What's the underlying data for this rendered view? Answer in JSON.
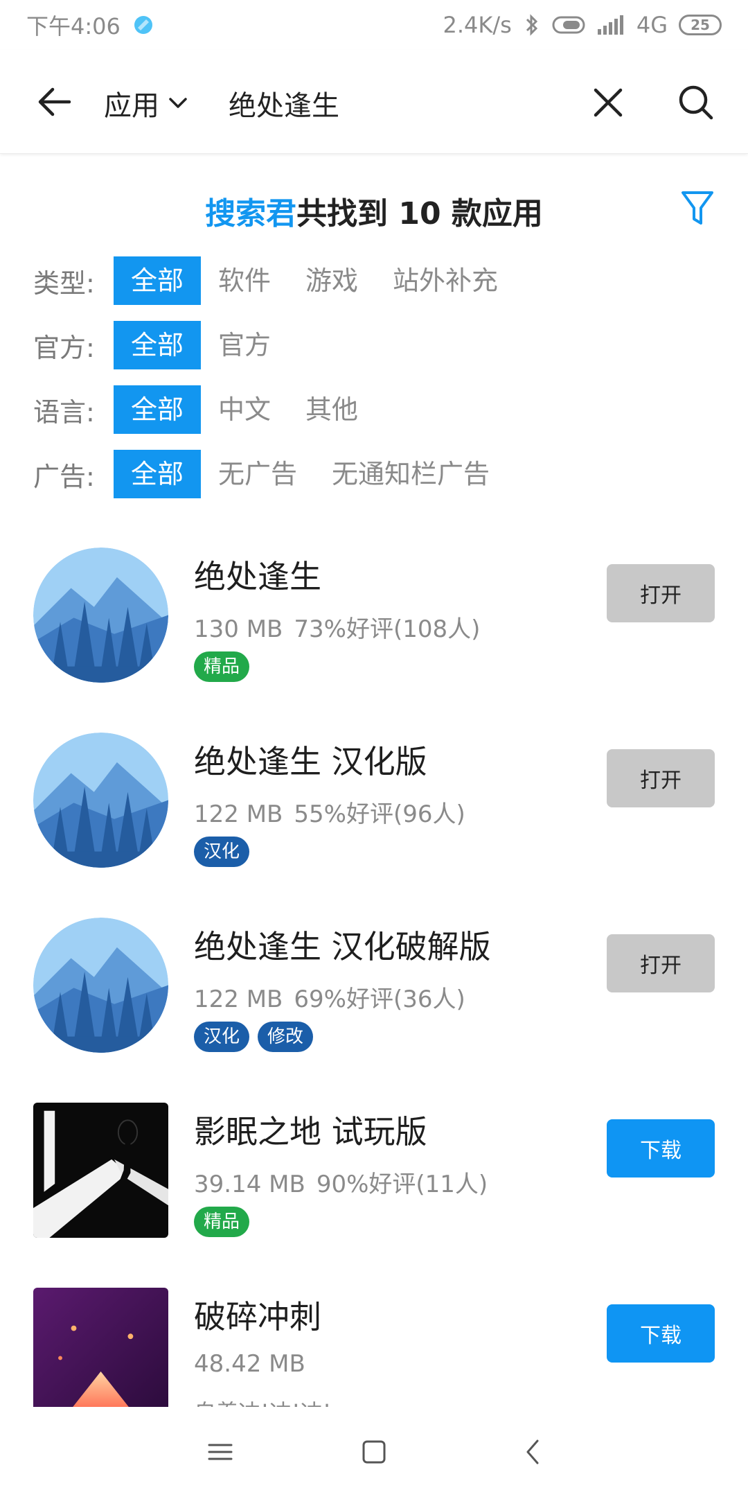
{
  "status_bar": {
    "time": "下午4:06",
    "net_speed": "2.4K/s",
    "network": "4G",
    "battery": "25"
  },
  "header": {
    "scope_label": "应用",
    "query": "绝处逢生"
  },
  "summary": {
    "brand": "搜索君",
    "text": "共找到 10 款应用"
  },
  "filters": [
    {
      "label": "类型:",
      "options": [
        "全部",
        "软件",
        "游戏",
        "站外补充"
      ],
      "active": 0
    },
    {
      "label": "官方:",
      "options": [
        "全部",
        "官方"
      ],
      "active": 0
    },
    {
      "label": "语言:",
      "options": [
        "全部",
        "中文",
        "其他"
      ],
      "active": 0
    },
    {
      "label": "广告:",
      "options": [
        "全部",
        "无广告",
        "无通知栏广告"
      ],
      "active": 0
    }
  ],
  "apps": [
    {
      "name": "绝处逢生",
      "size": "130 MB",
      "rating": "73%好评(108人)",
      "tags": [
        "精品"
      ],
      "button": "打开"
    },
    {
      "name": "绝处逢生 汉化版",
      "size": "122 MB",
      "rating": "55%好评(96人)",
      "tags": [
        "汉化"
      ],
      "button": "打开"
    },
    {
      "name": "绝处逢生 汉化破解版",
      "size": "122 MB",
      "rating": "69%好评(36人)",
      "tags": [
        "汉化",
        "修改"
      ],
      "button": "打开"
    },
    {
      "name": "影眠之地 试玩版",
      "size": "39.14 MB",
      "rating": "90%好评(11人)",
      "tags": [
        "精品"
      ],
      "button": "下载"
    },
    {
      "name": "破碎冲刺",
      "size": "48.42 MB",
      "rating": "",
      "subtitle": "自养冲!冲!冲!",
      "tags": [],
      "button": "下载"
    }
  ],
  "colors": {
    "accent": "#1296f0",
    "tag_green": "#22a94a",
    "tag_blue": "#1b5ea9",
    "open_button": "#c8c8c8",
    "download_button": "#0f95f3"
  }
}
